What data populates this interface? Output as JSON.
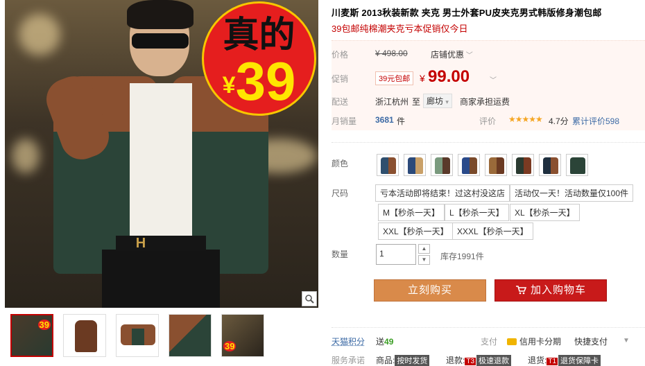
{
  "product": {
    "title": "川麦斯 2013秋装新款 夹克 男士外套PU皮夹克男式韩版修身潮包邮",
    "subtitle": "39包邮纯棉潮夹克亏本促销仅今日"
  },
  "image_badge": {
    "top_text": "真的",
    "currency": "¥",
    "price": "39"
  },
  "thumbnails": [
    {
      "name": "thumb-1",
      "badge": "39"
    },
    {
      "name": "thumb-2",
      "badge": ""
    },
    {
      "name": "thumb-3",
      "badge": ""
    },
    {
      "name": "thumb-4",
      "badge": ""
    },
    {
      "name": "thumb-5",
      "badge": "39"
    }
  ],
  "pricing": {
    "list_label": "价格",
    "list_price": "¥ 498.00",
    "shop_discount": "店铺优惠",
    "promo_label": "促销",
    "promo_tag": "39元包邮",
    "currency": "¥",
    "promo_price": "99.00"
  },
  "shipping": {
    "label": "配送",
    "from": "浙江杭州",
    "to_word": "至",
    "destination": "廊坊",
    "fee_text": "商家承担运费"
  },
  "sales": {
    "label": "月销量",
    "count": "3681",
    "unit": "件",
    "rating_label": "评价",
    "stars": "★★★★★",
    "score": "4.7分",
    "reviews_text": "累计评价598"
  },
  "colors": {
    "label": "颜色",
    "swatches": [
      {
        "main": "#2f4f6e",
        "accent": "#8a5030"
      },
      {
        "main": "#2c4a7a",
        "accent": "#c9a068"
      },
      {
        "main": "#7a9a7e",
        "accent": "#5a3a2a"
      },
      {
        "main": "#2a4a8a",
        "accent": "#7a4a2a"
      },
      {
        "main": "#9a6a3a",
        "accent": "#6b3a22"
      },
      {
        "main": "#2a3a30",
        "accent": "#7a3a22"
      },
      {
        "main": "#1f2f3f",
        "accent": "#8a5030"
      },
      {
        "main": "#2b4438",
        "accent": "#2b4438"
      }
    ]
  },
  "sizes": {
    "label": "尺码",
    "options": [
      "亏本活动即将结束！过这村没这店",
      "活动仅一天！活动数量仅100件",
      "M【秒杀一天】",
      "L【秒杀一天】",
      "XL【秒杀一天】",
      "XXL【秒杀一天】",
      "XXXL【秒杀一天】"
    ]
  },
  "quantity": {
    "label": "数量",
    "value": "1",
    "up": "▲",
    "down": "▼",
    "stock": "库存1991件"
  },
  "actions": {
    "buy_now": "立刻购买",
    "add_to_cart": "加入购物车"
  },
  "footer": {
    "points_label": "天猫积分",
    "points_prefix": "送",
    "points_value": "49",
    "payment_label": "支付",
    "credit_installment": "信用卡分期",
    "quick_pay": "快捷支付",
    "service_label": "服务承诺",
    "goods_label": "商品:",
    "goods_tag": "按时发货",
    "refund_label": "退款:",
    "refund_code": "T3",
    "refund_tag": "极速退款",
    "return_label": "退货:",
    "return_code": "T1",
    "return_tag": "退货保障卡"
  }
}
